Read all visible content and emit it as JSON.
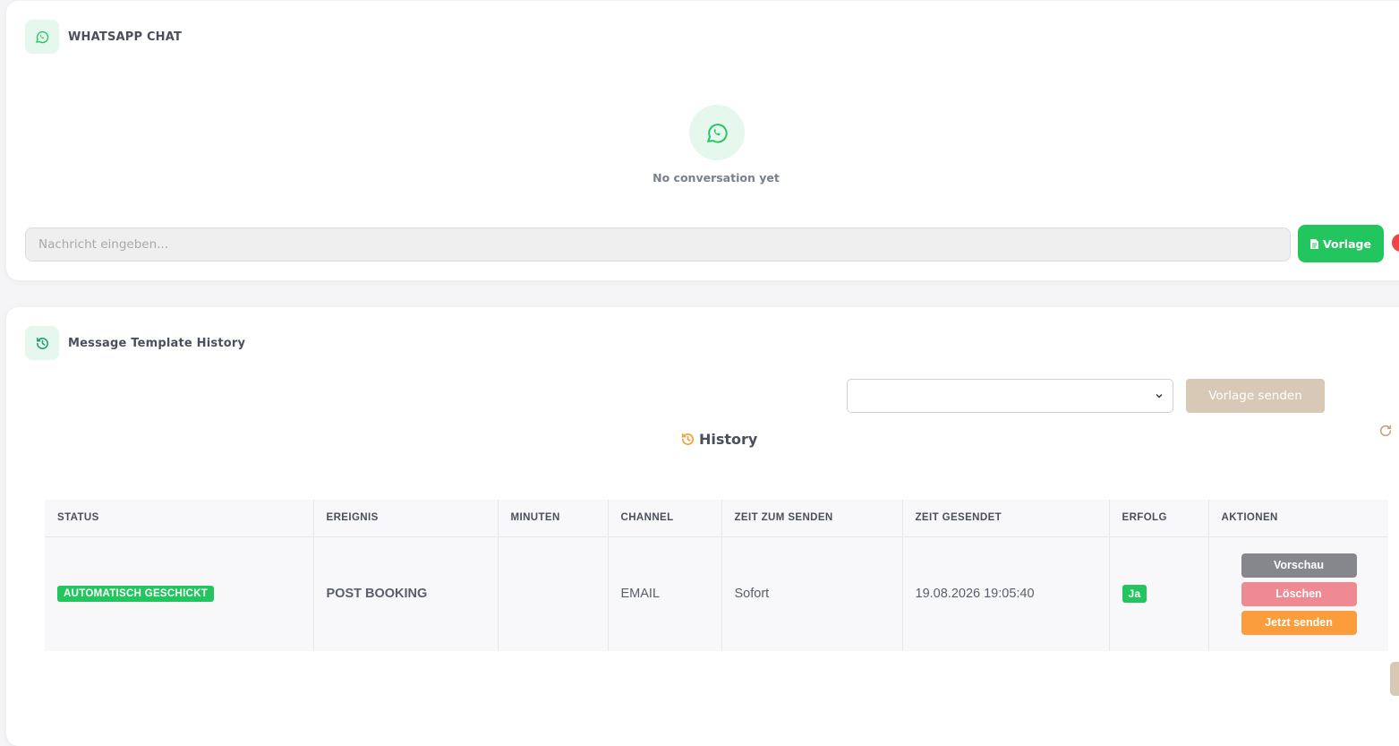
{
  "chat": {
    "title": "WHATSAPP CHAT",
    "empty_text": "No conversation yet",
    "input_placeholder": "Nachricht eingeben...",
    "template_button": "Vorlage"
  },
  "history_card": {
    "title": "Message Template History",
    "select_value": "",
    "send_template_button": "Vorlage senden",
    "heading": "History"
  },
  "table": {
    "headers": [
      "STATUS",
      "EREIGNIS",
      "MINUTEN",
      "CHANNEL",
      "ZEIT ZUM SENDEN",
      "ZEIT GESENDET",
      "ERFOLG",
      "AKTIONEN"
    ],
    "rows": [
      {
        "status": "AUTOMATISCH GESCHICKT",
        "event": "POST BOOKING",
        "minutes": "",
        "channel": "EMAIL",
        "time_to_send": "Sofort",
        "time_sent": "19.08.2026 19:05:40",
        "success": "Ja",
        "actions": {
          "preview": "Vorschau",
          "delete": "Löschen",
          "send_now": "Jetzt senden"
        }
      }
    ]
  },
  "colors": {
    "whatsapp_green": "#22c55e",
    "accent_orange": "#fb9d3d",
    "delete_pink": "#ef8a93",
    "template_button_beige": "#d8c9b6"
  },
  "icons": {
    "chat_header": "whatsapp-icon",
    "empty_state": "whatsapp-icon",
    "template_button": "document-icon",
    "history_header": "history-icon",
    "history_heading": "history-icon",
    "refresh": "refresh-icon",
    "select": "chevron-down-icon"
  }
}
